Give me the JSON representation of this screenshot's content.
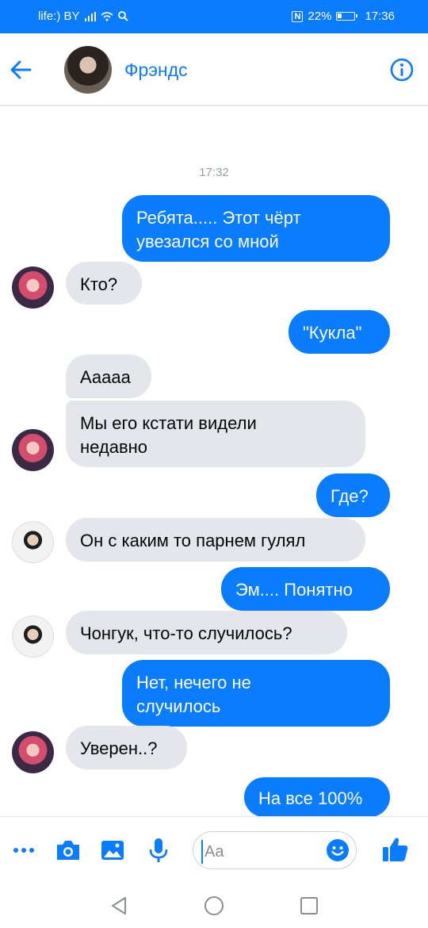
{
  "status_bar": {
    "carrier": "life:) BY",
    "nfc": "N",
    "battery": "22%",
    "time": "17:36"
  },
  "header": {
    "title": "Фрэндс",
    "back_icon": "back-arrow-icon",
    "info_icon": "info-icon"
  },
  "chat": {
    "timestamp": "17:32",
    "messages": [
      {
        "dir": "out",
        "text": "Ребята..... Этот чёрт\nувезался со мной"
      },
      {
        "dir": "in",
        "text": "Кто?"
      },
      {
        "dir": "out",
        "text": "\"Кукла\""
      },
      {
        "dir": "in",
        "text": "Ааааа"
      },
      {
        "dir": "in",
        "text": "Мы его кстати видели\nнедавно"
      },
      {
        "dir": "out",
        "text": "Где?"
      },
      {
        "dir": "in",
        "text": "Он с каким то парнем гулял"
      },
      {
        "dir": "out",
        "text": "Эм.... Понятно"
      },
      {
        "dir": "in",
        "text": "Чонгук, что-то случилось?"
      },
      {
        "dir": "out",
        "text": "Нет, нечего не\nслучилось"
      },
      {
        "dir": "in",
        "text": "Уверен..?"
      },
      {
        "dir": "out",
        "text": "На все 100%"
      }
    ]
  },
  "composer": {
    "placeholder": "Aa",
    "icons": [
      "more-icon",
      "camera-icon",
      "gallery-icon",
      "microphone-icon",
      "emoji-icon",
      "thumbs-up-icon"
    ]
  },
  "colors": {
    "accent": "#0a7cff",
    "incoming_bubble": "#e4e6eb"
  }
}
